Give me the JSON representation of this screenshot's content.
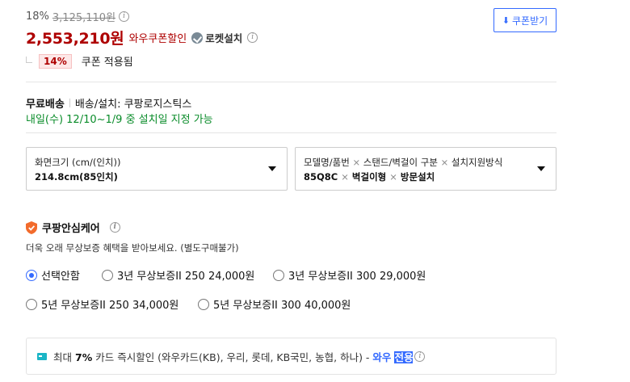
{
  "price": {
    "discount_rate": "18%",
    "original_price": "3,125,110원",
    "sale_price": "2,553,210원",
    "coupon_label": "와우쿠폰할인",
    "rocket_label": "로켓설치"
  },
  "coupon_button": {
    "label": "쿠폰받기"
  },
  "coupon_applied": {
    "badge": "14%",
    "text": "쿠폰 적용됨"
  },
  "shipping": {
    "free_label": "무료배송",
    "method": "배송/설치: 쿠팡로지스틱스",
    "schedule": "내일(수) 12/10~1/9 중 설치일 지정 가능"
  },
  "options": {
    "screen_size": {
      "label": "화면크기 (cm/(인치))",
      "value": "214.8cm(85인치)"
    },
    "combo": {
      "label_parts": [
        "모델명/품번",
        "스탠드/벽걸이 구분",
        "설치지원방식"
      ],
      "value_parts": [
        "85Q8C",
        "벽걸이형",
        "방문설치"
      ],
      "separator": "×"
    }
  },
  "care": {
    "title": "쿠팡안심케어",
    "subtitle": "더욱 오래 무상보증 혜택을 받아보세요. (별도구매불가)",
    "choices": [
      {
        "label": "선택안함",
        "checked": true
      },
      {
        "label": "3년 무상보증II 250 24,000원",
        "checked": false
      },
      {
        "label": "3년 무상보증II 300 29,000원",
        "checked": false
      },
      {
        "label": "5년 무상보증II 250 34,000원",
        "checked": false
      },
      {
        "label": "5년 무상보증II 300 40,000원",
        "checked": false
      }
    ]
  },
  "card_discount": {
    "prefix": "최대",
    "rate": "7%",
    "text": "카드 즉시할인 (와우카드(KB), 우리, 롯데, KB국민, 농협, 하나) -",
    "wow": "와우",
    "exclusive": "전용"
  },
  "colors": {
    "price_red": "#ae0000",
    "accent_blue": "#346aff",
    "delivery_green": "#0a8c2a",
    "shield_orange": "#f26b2c"
  }
}
